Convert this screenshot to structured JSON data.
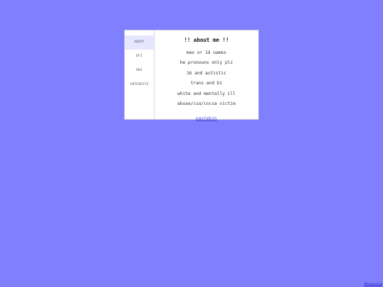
{
  "colors": {
    "background": "#8080ff",
    "card": "#ffffff",
    "active_tab": "#e6e6ff",
    "link": "#4a4ad0"
  },
  "sidebar": {
    "items": [
      {
        "label": "ABOUT",
        "active": true
      },
      {
        "label": "DFI",
        "active": false
      },
      {
        "label": "DNI",
        "active": false
      },
      {
        "label": "INTERESTS",
        "active": false
      }
    ]
  },
  "main": {
    "title": "!! about me !!",
    "lines": [
      "max or 1d names",
      "he pronouns only plz",
      "16 and autistic",
      "trans and bi",
      "white and mentally ill",
      "abuse/csa/cocsa victim"
    ],
    "link_label": "pastebin"
  },
  "footer": {
    "link_label": "Responsive"
  }
}
